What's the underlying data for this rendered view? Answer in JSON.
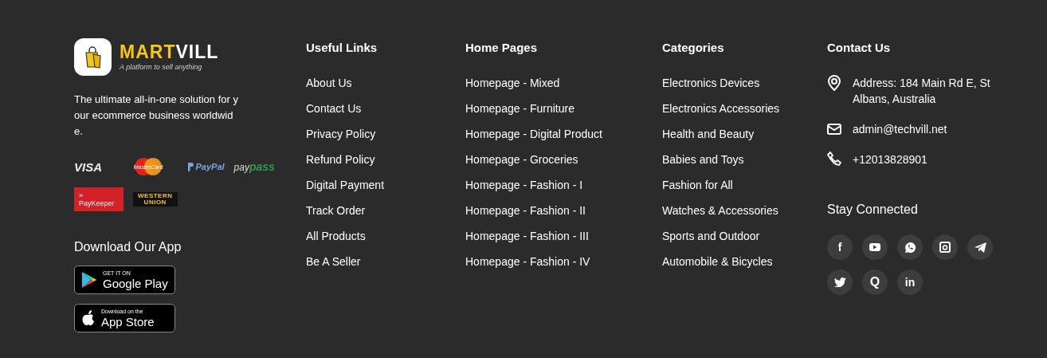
{
  "brand": {
    "name_first": "MART",
    "name_second": "VILL",
    "tagline": "A platform to sell anything",
    "description": "The ultimate all-in-one solution for your ecommerce business worldwide."
  },
  "payments": [
    {
      "kind": "visa",
      "label": "VISA"
    },
    {
      "kind": "mastercard",
      "label": "MasterCard"
    },
    {
      "kind": "paypal",
      "label": "PayPal"
    },
    {
      "kind": "paypass",
      "label": "pay",
      "label2": "pass"
    },
    {
      "kind": "paykeeper",
      "mark": "»",
      "label": "PayKeeper"
    },
    {
      "kind": "western",
      "label": "WESTERN",
      "label2": "UNION"
    }
  ],
  "app": {
    "title": "Download Our App",
    "badges": [
      {
        "kind": "google",
        "small": "GET IT ON",
        "big": "Google Play"
      },
      {
        "kind": "apple",
        "small": "Download on the",
        "big": "App Store"
      }
    ]
  },
  "columns": [
    {
      "title": "Useful Links",
      "links": [
        "About Us",
        "Contact Us",
        "Privacy Policy",
        "Refund Policy",
        "Digital Payment",
        "Track Order",
        "All Products",
        "Be A Seller"
      ]
    },
    {
      "title": "Home Pages",
      "links": [
        "Homepage - Mixed",
        "Homepage - Furniture",
        "Homepage - Digital Product",
        "Homepage - Groceries",
        "Homepage - Fashion - I",
        "Homepage - Fashion - II",
        "Homepage - Fashion - III",
        "Homepage - Fashion - IV"
      ]
    },
    {
      "title": "Categories",
      "links": [
        "Electronics Devices",
        "Electronics Accessories",
        "Health and Beauty",
        "Babies and Toys",
        "Fashion for All",
        "Watches & Accessories",
        "Sports and Outdoor",
        "Automobile & Bicycles"
      ]
    }
  ],
  "contact": {
    "title": "Contact Us",
    "items": [
      {
        "kind": "address",
        "text": "Address: 184 Main Rd E, St Albans, Australia"
      },
      {
        "kind": "email",
        "text": "admin@techvill.net"
      },
      {
        "kind": "phone",
        "text": "+12013828901"
      }
    ]
  },
  "social": {
    "title": "Stay Connected",
    "items": [
      {
        "kind": "facebook",
        "glyph": "f"
      },
      {
        "kind": "youtube"
      },
      {
        "kind": "whatsapp"
      },
      {
        "kind": "instagram"
      },
      {
        "kind": "telegram"
      },
      {
        "kind": "twitter"
      },
      {
        "kind": "quora",
        "glyph": "Q"
      },
      {
        "kind": "linkedin",
        "glyph": "in"
      }
    ]
  }
}
